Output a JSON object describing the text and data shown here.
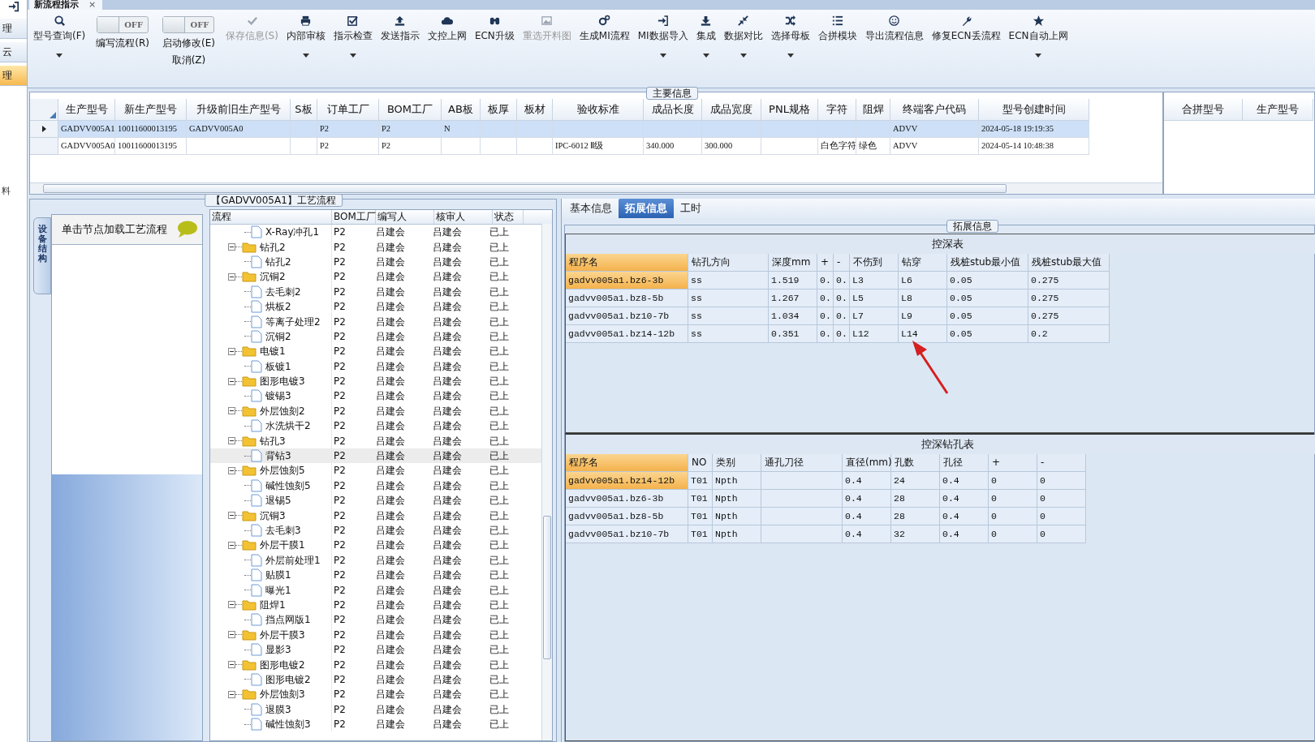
{
  "sidebar": {
    "items": [
      {
        "label": "理",
        "selected": false
      },
      {
        "label": "云",
        "selected": false
      },
      {
        "label": "理",
        "selected": true
      }
    ],
    "lower_text": "料"
  },
  "document_tab": {
    "title": "新流程指示",
    "close": "×"
  },
  "toolbar": [
    {
      "kind": "button",
      "label": "型号查询(F)",
      "disabled": false,
      "dropdown": true
    },
    {
      "kind": "toggle",
      "switch_text": "OFF",
      "on": false,
      "label": "编写流程(R)"
    },
    {
      "kind": "toggle",
      "switch_text": "OFF",
      "on": false,
      "label": "启动修改(E)",
      "sublabel": "取消(Z)"
    },
    {
      "kind": "button",
      "label": "保存信息(S)",
      "disabled": true,
      "dropdown": false
    },
    {
      "kind": "button",
      "label": "内部审核",
      "disabled": false,
      "dropdown": true
    },
    {
      "kind": "button",
      "label": "指示检查",
      "disabled": false,
      "dropdown": true
    },
    {
      "kind": "button",
      "label": "发送指示",
      "disabled": false,
      "dropdown": false
    },
    {
      "kind": "button",
      "label": "文控上网",
      "disabled": false,
      "dropdown": false
    },
    {
      "kind": "button",
      "label": "ECN升级",
      "disabled": false,
      "dropdown": false
    },
    {
      "kind": "button",
      "label": "重选开料图",
      "disabled": true,
      "dropdown": false
    },
    {
      "kind": "button",
      "label": "生成MI流程",
      "disabled": false,
      "dropdown": false
    },
    {
      "kind": "button",
      "label": "MI数据导入",
      "disabled": false,
      "dropdown": true
    },
    {
      "kind": "button",
      "label": "集成",
      "disabled": false,
      "dropdown": true
    },
    {
      "kind": "button",
      "label": "数据对比",
      "disabled": false,
      "dropdown": true
    },
    {
      "kind": "button",
      "label": "选择母板",
      "disabled": false,
      "dropdown": true
    },
    {
      "kind": "button",
      "label": "合拼模块",
      "disabled": false,
      "dropdown": false
    },
    {
      "kind": "button",
      "label": "导出流程信息",
      "disabled": false,
      "dropdown": false
    },
    {
      "kind": "button",
      "label": "修复ECN丢流程",
      "disabled": false,
      "dropdown": false
    },
    {
      "kind": "button",
      "label": "ECN自动上网",
      "disabled": false,
      "dropdown": true
    }
  ],
  "main_info": {
    "title": "主要信息",
    "columns": [
      "生产型号",
      "新生产型号",
      "升级前旧生产型号",
      "S板",
      "订单工厂",
      "BOM工厂",
      "AB板",
      "板厚",
      "板材",
      "验收标准",
      "成品长度",
      "成品宽度",
      "PNL规格",
      "字符",
      "阻焊",
      "终端客户代码",
      "型号创建时间"
    ],
    "rows": [
      {
        "selected": true,
        "cells": [
          "GADVV005A1",
          "10011600013195",
          "GADVV005A0",
          "",
          "P2",
          "P2",
          "N",
          "",
          "",
          "",
          "",
          "",
          "",
          "",
          "",
          "ADVV",
          "2024-05-18 19:19:35"
        ]
      },
      {
        "selected": false,
        "cells": [
          "GADVV005A0",
          "10011600013195",
          "",
          "",
          "P2",
          "P2",
          "",
          "",
          "",
          "IPC-6012 Ⅱ级",
          "340.000",
          "300.000",
          "",
          "白色字符",
          "绿色",
          "ADVV",
          "2024-05-14 10:48:38"
        ]
      }
    ],
    "side_columns": [
      "合拼型号",
      "生产型号"
    ]
  },
  "process": {
    "title": "【GADVV005A1】工艺流程",
    "side_tab": "设备结构",
    "hint": "单击节点加载工艺流程",
    "columns": [
      "流程",
      "BOM工厂",
      "编写人",
      "核审人",
      "状态"
    ],
    "tree": [
      {
        "kind": "file",
        "name": "X-Ray冲孔1",
        "bom": "P2",
        "writer": "吕建会",
        "reviewer": "吕建会",
        "status": "已上",
        "selected": false
      },
      {
        "kind": "folder",
        "name": "钻孔2",
        "bom": "P2",
        "writer": "吕建会",
        "reviewer": "吕建会",
        "status": "已上",
        "selected": false,
        "expanded": true,
        "children": [
          {
            "kind": "file",
            "name": "钻孔2",
            "bom": "P2",
            "writer": "吕建会",
            "reviewer": "吕建会",
            "status": "已上",
            "selected": false
          }
        ]
      },
      {
        "kind": "folder",
        "name": "沉铜2",
        "bom": "P2",
        "writer": "吕建会",
        "reviewer": "吕建会",
        "status": "已上",
        "selected": false,
        "expanded": true,
        "children": [
          {
            "kind": "file",
            "name": "去毛刺2",
            "bom": "P2",
            "writer": "吕建会",
            "reviewer": "吕建会",
            "status": "已上",
            "selected": false
          },
          {
            "kind": "file",
            "name": "烘板2",
            "bom": "P2",
            "writer": "吕建会",
            "reviewer": "吕建会",
            "status": "已上",
            "selected": false
          },
          {
            "kind": "file",
            "name": "等离子处理2",
            "bom": "P2",
            "writer": "吕建会",
            "reviewer": "吕建会",
            "status": "已上",
            "selected": false
          },
          {
            "kind": "file",
            "name": "沉铜2",
            "bom": "P2",
            "writer": "吕建会",
            "reviewer": "吕建会",
            "status": "已上",
            "selected": false
          }
        ]
      },
      {
        "kind": "folder",
        "name": "电镀1",
        "bom": "P2",
        "writer": "吕建会",
        "reviewer": "吕建会",
        "status": "已上",
        "selected": false,
        "expanded": true,
        "children": [
          {
            "kind": "file",
            "name": "板镀1",
            "bom": "P2",
            "writer": "吕建会",
            "reviewer": "吕建会",
            "status": "已上",
            "selected": false
          }
        ]
      },
      {
        "kind": "folder",
        "name": "图形电镀3",
        "bom": "P2",
        "writer": "吕建会",
        "reviewer": "吕建会",
        "status": "已上",
        "selected": false,
        "expanded": true,
        "children": [
          {
            "kind": "file",
            "name": "镀锡3",
            "bom": "P2",
            "writer": "吕建会",
            "reviewer": "吕建会",
            "status": "已上",
            "selected": false
          }
        ]
      },
      {
        "kind": "folder",
        "name": "外层蚀刻2",
        "bom": "P2",
        "writer": "吕建会",
        "reviewer": "吕建会",
        "status": "已上",
        "selected": false,
        "expanded": true,
        "children": [
          {
            "kind": "file",
            "name": "水洗烘干2",
            "bom": "P2",
            "writer": "吕建会",
            "reviewer": "吕建会",
            "status": "已上",
            "selected": false
          }
        ]
      },
      {
        "kind": "folder",
        "name": "钻孔3",
        "bom": "P2",
        "writer": "吕建会",
        "reviewer": "吕建会",
        "status": "已上",
        "selected": false,
        "expanded": true,
        "children": [
          {
            "kind": "file",
            "name": "背钻3",
            "bom": "P2",
            "writer": "吕建会",
            "reviewer": "吕建会",
            "status": "已上",
            "selected": true
          }
        ]
      },
      {
        "kind": "folder",
        "name": "外层蚀刻5",
        "bom": "P2",
        "writer": "吕建会",
        "reviewer": "吕建会",
        "status": "已上",
        "selected": false,
        "expanded": true,
        "children": [
          {
            "kind": "file",
            "name": "碱性蚀刻5",
            "bom": "P2",
            "writer": "吕建会",
            "reviewer": "吕建会",
            "status": "已上",
            "selected": false
          },
          {
            "kind": "file",
            "name": "退锡5",
            "bom": "P2",
            "writer": "吕建会",
            "reviewer": "吕建会",
            "status": "已上",
            "selected": false
          }
        ]
      },
      {
        "kind": "folder",
        "name": "沉铜3",
        "bom": "P2",
        "writer": "吕建会",
        "reviewer": "吕建会",
        "status": "已上",
        "selected": false,
        "expanded": true,
        "children": [
          {
            "kind": "file",
            "name": "去毛刺3",
            "bom": "P2",
            "writer": "吕建会",
            "reviewer": "吕建会",
            "status": "已上",
            "selected": false
          }
        ]
      },
      {
        "kind": "folder",
        "name": "外层干膜1",
        "bom": "P2",
        "writer": "吕建会",
        "reviewer": "吕建会",
        "status": "已上",
        "selected": false,
        "expanded": true,
        "children": [
          {
            "kind": "file",
            "name": "外层前处理1",
            "bom": "P2",
            "writer": "吕建会",
            "reviewer": "吕建会",
            "status": "已上",
            "selected": false
          },
          {
            "kind": "file",
            "name": "贴膜1",
            "bom": "P2",
            "writer": "吕建会",
            "reviewer": "吕建会",
            "status": "已上",
            "selected": false
          },
          {
            "kind": "file",
            "name": "曝光1",
            "bom": "P2",
            "writer": "吕建会",
            "reviewer": "吕建会",
            "status": "已上",
            "selected": false
          }
        ]
      },
      {
        "kind": "folder",
        "name": "阻焊1",
        "bom": "P2",
        "writer": "吕建会",
        "reviewer": "吕建会",
        "status": "已上",
        "selected": false,
        "expanded": true,
        "children": [
          {
            "kind": "file",
            "name": "挡点网版1",
            "bom": "P2",
            "writer": "吕建会",
            "reviewer": "吕建会",
            "status": "已上",
            "selected": false
          }
        ]
      },
      {
        "kind": "folder",
        "name": "外层干膜3",
        "bom": "P2",
        "writer": "吕建会",
        "reviewer": "吕建会",
        "status": "已上",
        "selected": false,
        "expanded": true,
        "children": [
          {
            "kind": "file",
            "name": "显影3",
            "bom": "P2",
            "writer": "吕建会",
            "reviewer": "吕建会",
            "status": "已上",
            "selected": false
          }
        ]
      },
      {
        "kind": "folder",
        "name": "图形电镀2",
        "bom": "P2",
        "writer": "吕建会",
        "reviewer": "吕建会",
        "status": "已上",
        "selected": false,
        "expanded": true,
        "children": [
          {
            "kind": "file",
            "name": "图形电镀2",
            "bom": "P2",
            "writer": "吕建会",
            "reviewer": "吕建会",
            "status": "已上",
            "selected": false
          }
        ]
      },
      {
        "kind": "folder",
        "name": "外层蚀刻3",
        "bom": "P2",
        "writer": "吕建会",
        "reviewer": "吕建会",
        "status": "已上",
        "selected": false,
        "expanded": true,
        "children": [
          {
            "kind": "file",
            "name": "退膜3",
            "bom": "P2",
            "writer": "吕建会",
            "reviewer": "吕建会",
            "status": "已上",
            "selected": false
          },
          {
            "kind": "file",
            "name": "碱性蚀刻3",
            "bom": "P2",
            "writer": "吕建会",
            "reviewer": "吕建会",
            "status": "已上",
            "selected": false
          }
        ]
      }
    ]
  },
  "detail": {
    "tabs": [
      {
        "label": "基本信息",
        "selected": false
      },
      {
        "label": "拓展信息",
        "selected": true
      },
      {
        "label": "工时",
        "selected": false
      }
    ],
    "group_title": "拓展信息",
    "depth_table": {
      "title": "控深表",
      "columns": [
        "程序名",
        "钻孔方向",
        "深度mm",
        "+",
        "-",
        "不伤到",
        "钻穿",
        "残桩stub最小值",
        "残桩stub最大值"
      ],
      "rows": [
        {
          "selected": true,
          "cells": [
            "gadvv005a1.bz6-3b",
            "ss",
            "1.519",
            "0.",
            "0.",
            "L3",
            "L6",
            "0.05",
            "0.275"
          ]
        },
        {
          "selected": false,
          "cells": [
            "gadvv005a1.bz8-5b",
            "ss",
            "1.267",
            "0.",
            "0.",
            "L5",
            "L8",
            "0.05",
            "0.275"
          ]
        },
        {
          "selected": false,
          "cells": [
            "gadvv005a1.bz10-7b",
            "ss",
            "1.034",
            "0.",
            "0.",
            "L7",
            "L9",
            "0.05",
            "0.275"
          ]
        },
        {
          "selected": false,
          "cells": [
            "gadvv005a1.bz14-12b",
            "ss",
            "0.351",
            "0.",
            "0.",
            "L12",
            "L14",
            "0.05",
            "0.2"
          ]
        }
      ]
    },
    "hole_table": {
      "title": "控深钻孔表",
      "columns": [
        "程序名",
        "NO",
        "类别",
        "通孔刀径",
        "直径(mm)",
        "孔数",
        "孔径",
        "+",
        "-"
      ],
      "rows": [
        {
          "selected": true,
          "cells": [
            "gadvv005a1.bz14-12b",
            "T01",
            "Npth",
            "",
            "0.4",
            "24",
            "0.4",
            "0",
            "0"
          ]
        },
        {
          "selected": false,
          "cells": [
            "gadvv005a1.bz6-3b",
            "T01",
            "Npth",
            "",
            "0.4",
            "28",
            "0.4",
            "0",
            "0"
          ]
        },
        {
          "selected": false,
          "cells": [
            "gadvv005a1.bz8-5b",
            "T01",
            "Npth",
            "",
            "0.4",
            "28",
            "0.4",
            "0",
            "0"
          ]
        },
        {
          "selected": false,
          "cells": [
            "gadvv005a1.bz10-7b",
            "T01",
            "Npth",
            "",
            "0.4",
            "32",
            "0.4",
            "0",
            "0"
          ]
        }
      ]
    }
  }
}
